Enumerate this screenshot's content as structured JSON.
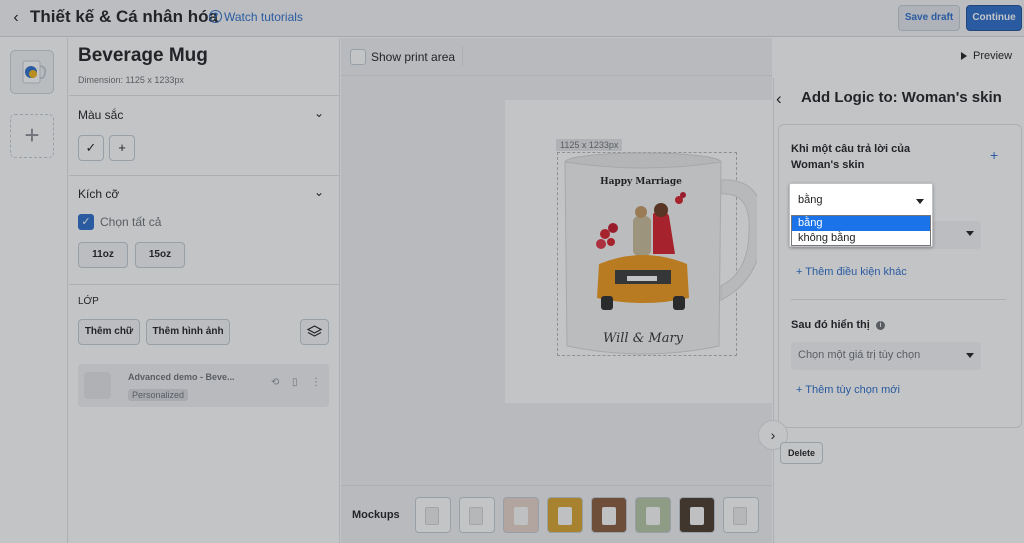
{
  "header": {
    "title": "Thiết kế & Cá nhân hóa",
    "help_link": "Watch tutorials",
    "save_draft_label": "Save draft",
    "continue_label": "Continue"
  },
  "panel": {
    "product_title": "Beverage Mug",
    "dimension": "Dimension: 1125 x 1233px",
    "color_section": {
      "title": "Màu sắc"
    },
    "size_section": {
      "title": "Kích cỡ",
      "select_all_label": "Chọn tất cả",
      "sizes": [
        "11oz",
        "15oz"
      ]
    },
    "layers": {
      "heading": "LỚP",
      "add_text_label": "Thêm chữ",
      "add_image_label": "Thêm hình ảnh",
      "items": [
        {
          "name": "Advanced demo - Beve...",
          "badge": "Personalized"
        }
      ]
    }
  },
  "canvas": {
    "show_print_area_label": "Show print area",
    "dimension_tag": "1125 x 1233px",
    "mug_text": {
      "top": "Happy Marriage",
      "bottom": "Will & Mary"
    },
    "mockups_label": "Mockups"
  },
  "logic": {
    "preview_label": "Preview",
    "title": "Add Logic to: Woman's skin",
    "when_label": "Khi một câu trả lời của Woman's skin",
    "condition": {
      "current_value": "bằng",
      "options": [
        "bằng",
        "không bằng"
      ],
      "selected_index": 0
    },
    "add_condition_label": "+ Thêm điều kiện khác",
    "then_label": "Sau đó hiển thị",
    "value_placeholder": "Chọn một giá trị tùy chọn",
    "add_option_label": "+ Thêm tùy chọn mới",
    "delete_label": "Delete"
  },
  "colors": {
    "primary": "#2c6ecb",
    "selected_option": "#1a73e8",
    "car": "#f29a1b",
    "dress": "#d71f2a"
  }
}
